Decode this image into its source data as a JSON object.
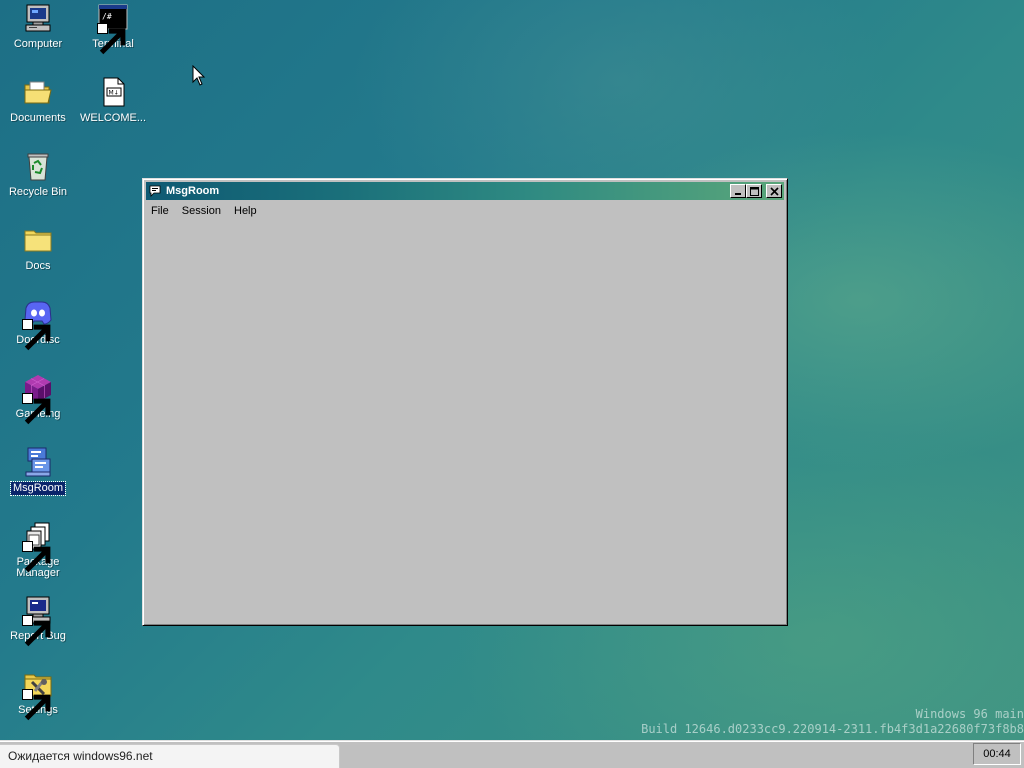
{
  "desktop": {
    "icons": [
      {
        "label": "Computer",
        "icon": "computer-icon",
        "shortcut": false
      },
      {
        "label": "Terminal",
        "icon": "terminal-icon",
        "shortcut": true
      },
      {
        "label": "Documents",
        "icon": "open-folder-icon",
        "shortcut": false
      },
      {
        "label": "WELCOME...",
        "icon": "markdown-file-icon",
        "shortcut": false
      },
      {
        "label": "Recycle Bin",
        "icon": "recycle-bin-icon",
        "shortcut": false
      },
      {
        "label": "Docs",
        "icon": "folder-icon",
        "shortcut": false
      },
      {
        "label": "Doordisc",
        "icon": "doordisc-icon",
        "shortcut": true
      },
      {
        "label": "Gameing",
        "icon": "cube-icon",
        "shortcut": true
      },
      {
        "label": "MsgRoom",
        "icon": "msgroom-icon",
        "shortcut": false,
        "selected": true
      },
      {
        "label": "Package Manager",
        "icon": "package-manager-icon",
        "shortcut": true
      },
      {
        "label": "Report Bug",
        "icon": "report-bug-icon",
        "shortcut": true
      },
      {
        "label": "Settings",
        "icon": "settings-icon",
        "shortcut": true
      }
    ],
    "watermark_line1": "Windows 96 main",
    "watermark_line2": "Build 12646.d0233cc9.220914-2311.fb4f3d1a22680f73f8b8"
  },
  "window": {
    "title": "MsgRoom",
    "menu": [
      "File",
      "Session",
      "Help"
    ]
  },
  "taskbar": {
    "status_text": "Ожидается windows96.net",
    "clock": "00:44"
  },
  "colors": {
    "desktop_base": "#237a8c",
    "window_face": "#c0c0c0",
    "titlebar_start": "#0f5a73",
    "titlebar_end": "#5aa67a",
    "selection": "#0a246a"
  }
}
